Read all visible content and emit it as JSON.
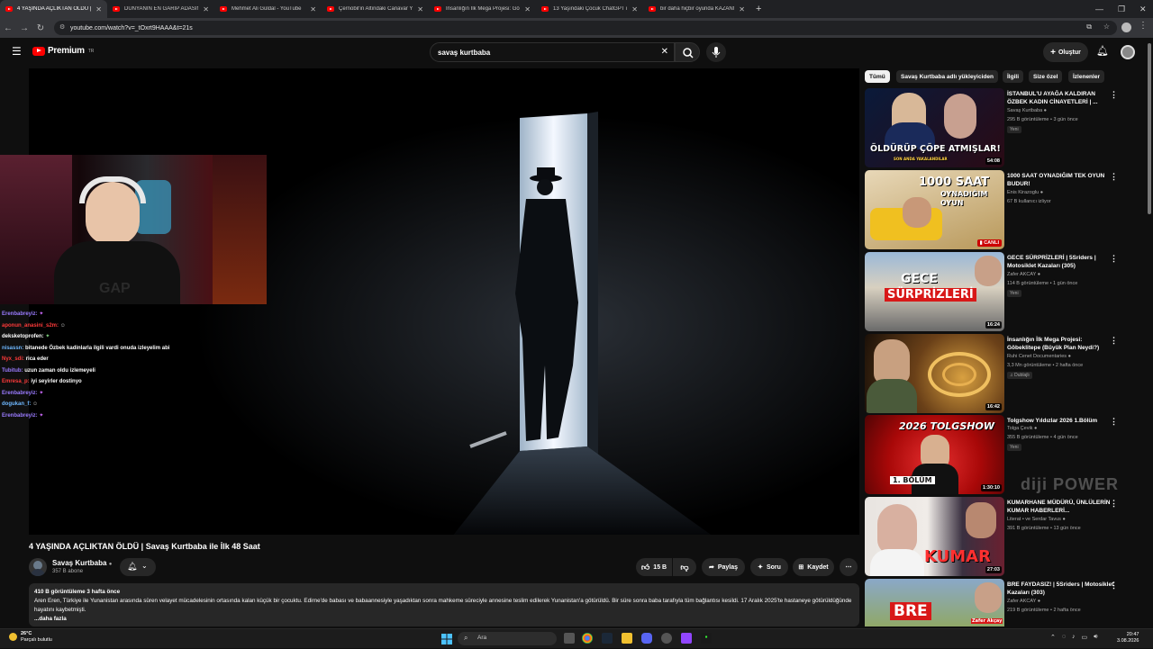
{
  "browser": {
    "tabs": [
      {
        "title": "4 YAŞINDA AÇLIKTAN ÖLDÜ | Sava",
        "active": true
      },
      {
        "title": "DÜNYANIN EN GARİP ADASINI",
        "active": false
      },
      {
        "title": "Mehmet Ali Güldal - YouTube",
        "active": false
      },
      {
        "title": "Çernobil'in Altındaki Canavar Y",
        "active": false
      },
      {
        "title": "İnsanlığın İlk Mega Projesi: Göbe",
        "active": false
      },
      {
        "title": "13 Yaşındaki Çocuk ChatGPT ile",
        "active": false
      },
      {
        "title": "bir daha hiçbir oyunda KAZANM",
        "active": false
      }
    ],
    "new_tab": "+",
    "url": "youtube.com/watch?v=_tOxrt9HAAA&t=21s"
  },
  "header": {
    "brand": "Premium",
    "country": "TR",
    "search_value": "savaş kurtbaba",
    "create_label": "Oluştur"
  },
  "player": {
    "chat": [
      {
        "user": "Erenbabreyiz:",
        "color": "#9b7bff",
        "msg": ""
      },
      {
        "user": "aponun_anasini_s2m:",
        "color": "#ff3a3a",
        "msg": ""
      },
      {
        "user": "deksketoprofen:",
        "color": "#ffffff",
        "msg": ""
      },
      {
        "user": "nisassn:",
        "color": "#6fb8ff",
        "msg": "bitanede Özbek kadinlarla ilgili vardi onuda izleyelim abi"
      },
      {
        "user": "Nyx_sdi:",
        "color": "#ff3a3a",
        "msg": "rica eder"
      },
      {
        "user": "Tubitub:",
        "color": "#9b7bff",
        "msg": "uzun zaman oldu izlemeyeli"
      },
      {
        "user": "Emresa_p:",
        "color": "#ff3a3a",
        "msg": "iyi seyirler dostinyo"
      },
      {
        "user": "Erenbabreyiz:",
        "color": "#9b7bff",
        "msg": ""
      },
      {
        "user": "dogukan_f:",
        "color": "#6fb8ff",
        "msg": ""
      },
      {
        "user": "Erenbabreyiz:",
        "color": "#9b7bff",
        "msg": ""
      }
    ]
  },
  "video": {
    "title": "4 YAŞINDA AÇLIKTAN ÖLDÜ | Savaş Kurtbaba ile İlk 48 Saat",
    "channel": "Savaş Kurtbaba",
    "subscribers": "357 B abone",
    "likes": "15 B",
    "share_label": "Paylaş",
    "ask_label": "Soru",
    "save_label": "Kaydet",
    "views_time": "410 B görüntüleme  3 hafta önce",
    "description": "Aren Eren, Türkiye ile Yunanistan arasında süren velayet mücadelesinin ortasında kalan küçük bir çocuktu. Edirne'de babası ve babaannesiyle yaşadıktan sonra mahkeme süreciyle annesine teslim edilerek Yunanistan'a götürüldü. Bir süre sonra baba tarafıyla tüm bağlantısı kesildi. 17 Aralık 2025'te hastaneye götürüldüğünde hayatını kaybetmişti.",
    "more": "...daha fazla"
  },
  "chips": [
    "Tümü",
    "Savaş Kurtbaba adlı yükleyiciden",
    "İlgili",
    "Size özel",
    "İzlenenler"
  ],
  "recommendations": [
    {
      "title": "İSTANBUL'U AYAĞA KALDIRAN ÖZBEK KADIN CİNAYETLERİ | ...",
      "channel": "Savaş Kurtbaba",
      "meta": "295 B görüntüleme • 3 gün önce",
      "badge": "Yeni",
      "duration": "54:08",
      "thumb_text": "ÖLDÜRÜP ÇÖPE ATMIŞLAR!",
      "thumb_sub": "SON ANDA YAKALANDILAR"
    },
    {
      "title": "1000 SAAT OYNADIĞIM TEK OYUN BUDUR!",
      "channel": "Enis Kirazoglu",
      "meta": "67 B kullanıcı izliyor",
      "badge": "",
      "duration": "CANLI",
      "thumb_text": "1000 SAAT",
      "thumb_sub": "OYNADIĞIM OYUN"
    },
    {
      "title": "GECE SÜRPRİZLERİ | 5Sriders | Motosiklet Kazaları (305)",
      "channel": "Zafer AKCAY",
      "meta": "114 B görüntüleme • 1 gün önce",
      "badge": "Yeni",
      "duration": "16:24",
      "thumb_text": "GECE",
      "thumb_sub": "SÜRPRİZLERİ"
    },
    {
      "title": "İnsanlığın İlk Mega Projesi: Göbeklitepe (Büyük Plan Neydi?)",
      "channel": "Ruhi Cenet Documentaries",
      "meta": "3,3 Mn görüntüleme • 2 hafta önce",
      "badge": "Dublajlı",
      "duration": "16:42",
      "thumb_text": "",
      "thumb_sub": ""
    },
    {
      "title": "Tolgshow Yıldızlar 2026 1.Bölüm",
      "channel": "Tolga Çevik",
      "meta": "355 B görüntüleme • 4 gün önce",
      "badge": "Yeni",
      "duration": "1:30:10",
      "thumb_text": "2026 TOLGSHOW",
      "thumb_sub": "1. BÖLÜM"
    },
    {
      "title": "KUMARHANE MÜDÜRÜ, ÜNLÜLERİN KUMAR HABERLERİ...",
      "channel": "Literat • ve Serdar Tavus",
      "meta": "391 B görüntüleme • 13 gün önce",
      "badge": "",
      "duration": "27:03",
      "thumb_text": "KUMAR",
      "thumb_sub": ""
    },
    {
      "title": "BRE FAYDASIZ! | 5Sriders | Motosiklet Kazaları (303)",
      "channel": "Zafer AKCAY",
      "meta": "219 B görüntüleme • 2 hafta önce",
      "badge": "",
      "duration": "",
      "thumb_text": "BRE",
      "thumb_sub": "Zafer Akçay"
    }
  ],
  "watermark": "diji POWER",
  "taskbar": {
    "temp": "26°C",
    "weather": "Parçalı bulutlu",
    "search": "Ara",
    "time": "20:47",
    "date": "3.08.2026"
  },
  "colors": {
    "youtube_red": "#ff0000",
    "background": "#0f0f0f",
    "chip_bg": "#272727",
    "live_red": "#cc0000"
  }
}
